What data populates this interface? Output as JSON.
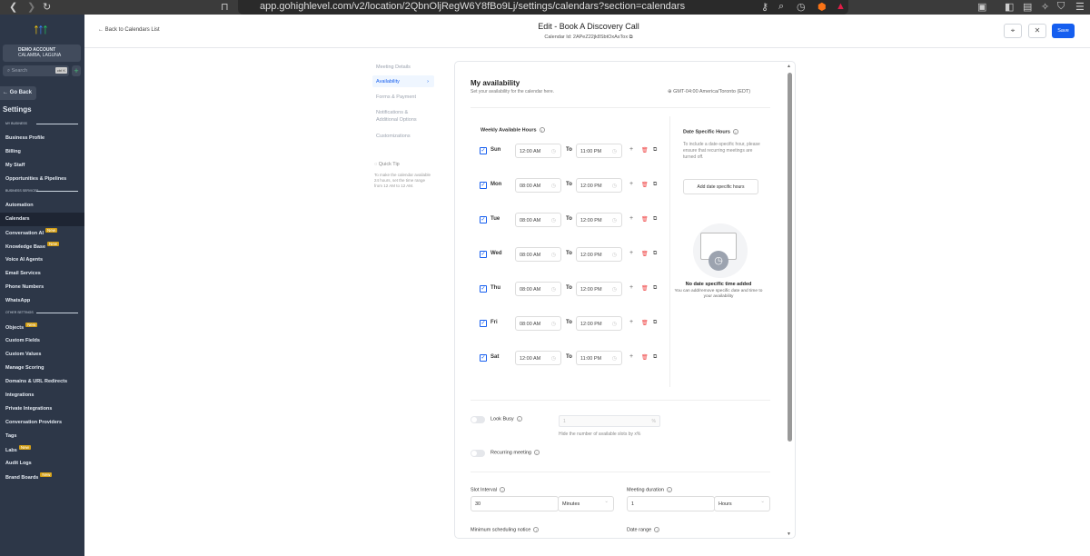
{
  "browser": {
    "url": "app.gohighlevel.com/v2/location/2QbnOljRegW6Y8fBo9Lj/settings/calendars?section=calendars"
  },
  "sidebar": {
    "account_name": "DEMO ACCOUNT",
    "account_location": "CALAMBA, LAGUNA",
    "search_placeholder": "Search",
    "search_shortcut": "ctrl K",
    "go_back": "← Go Back",
    "title": "Settings",
    "sections": {
      "my_business": "MY BUSINESS",
      "business_services": "BUSINESS SERVICES",
      "other_settings": "OTHER SETTINGS"
    },
    "badge_new": "New",
    "my_business": [
      {
        "label": "Business Profile"
      },
      {
        "label": "Billing"
      },
      {
        "label": "My Staff"
      },
      {
        "label": "Opportunities & Pipelines"
      }
    ],
    "business_services": [
      {
        "label": "Automation"
      },
      {
        "label": "Calendars",
        "active": true
      },
      {
        "label": "Conversation AI",
        "new": true
      },
      {
        "label": "Knowledge Base",
        "new": true
      },
      {
        "label": "Voice AI Agents"
      },
      {
        "label": "Email Services"
      },
      {
        "label": "Phone Numbers"
      },
      {
        "label": "WhatsApp"
      }
    ],
    "other_settings": [
      {
        "label": "Objects",
        "new": true
      },
      {
        "label": "Custom Fields"
      },
      {
        "label": "Custom Values"
      },
      {
        "label": "Manage Scoring"
      },
      {
        "label": "Domains & URL Redirects"
      },
      {
        "label": "Integrations"
      },
      {
        "label": "Private Integrations"
      },
      {
        "label": "Conversation Providers"
      },
      {
        "label": "Tags"
      },
      {
        "label": "Labs",
        "new": true
      },
      {
        "label": "Audit Logs"
      },
      {
        "label": "Brand Boards",
        "new": true
      }
    ]
  },
  "header": {
    "back": "Back to Calendars List",
    "title": "Edit - Book A Discovery Call",
    "calendar_id": "Calendar Id: 2APeZ22jk8SbtOxAsTox",
    "save": "Save"
  },
  "left_nav": {
    "items": [
      "Meeting Details",
      "Availability",
      "Forms & Payment",
      "Notifications & Additional Options",
      "Customizations"
    ],
    "active": "Availability",
    "tip_title": "Quick Tip",
    "tip_text": "To make the calendar available 24 hours, set the time range from 12 AM to 12 AM."
  },
  "availability": {
    "title": "My availability",
    "subtitle": "Set your availability for the calendar here.",
    "timezone": "GMT-04:00 America/Toronto (EDT)",
    "weekly_title": "Weekly Available Hours",
    "to": "To",
    "days": [
      {
        "day": "Sun",
        "from": "12:00 AM",
        "to": "11:00 PM",
        "checked": true
      },
      {
        "day": "Mon",
        "from": "08:00 AM",
        "to": "12:00 PM",
        "checked": true
      },
      {
        "day": "Tue",
        "from": "08:00 AM",
        "to": "12:00 PM",
        "checked": true
      },
      {
        "day": "Wed",
        "from": "08:00 AM",
        "to": "12:00 PM",
        "checked": true
      },
      {
        "day": "Thu",
        "from": "08:00 AM",
        "to": "12:00 PM",
        "checked": true
      },
      {
        "day": "Fri",
        "from": "08:00 AM",
        "to": "12:00 PM",
        "checked": true
      },
      {
        "day": "Sat",
        "from": "12:00 AM",
        "to": "11:00 PM",
        "checked": true
      }
    ],
    "date_specific": {
      "title": "Date Specific Hours",
      "desc": "To include a date-specific hour, please ensure that recurring meetings are turned off.",
      "button": "Add date specific hours",
      "empty_title": "No date specific time added",
      "empty_text": "You can add/remove specific date and time to your availability"
    },
    "look_busy": {
      "label": "Look Busy",
      "placeholder": "1",
      "suffix": "%",
      "hint": "Hide the number of available slots by x%",
      "enabled": false
    },
    "recurring": {
      "label": "Recurring meeting",
      "enabled": false
    },
    "slot_interval": {
      "label": "Slot Interval",
      "value": "30",
      "unit": "Minutes"
    },
    "meeting_duration": {
      "label": "Meeting duration",
      "value": "1",
      "unit": "Hours"
    },
    "min_notice": {
      "label": "Minimum scheduling notice"
    },
    "date_range": {
      "label": "Date range"
    }
  }
}
